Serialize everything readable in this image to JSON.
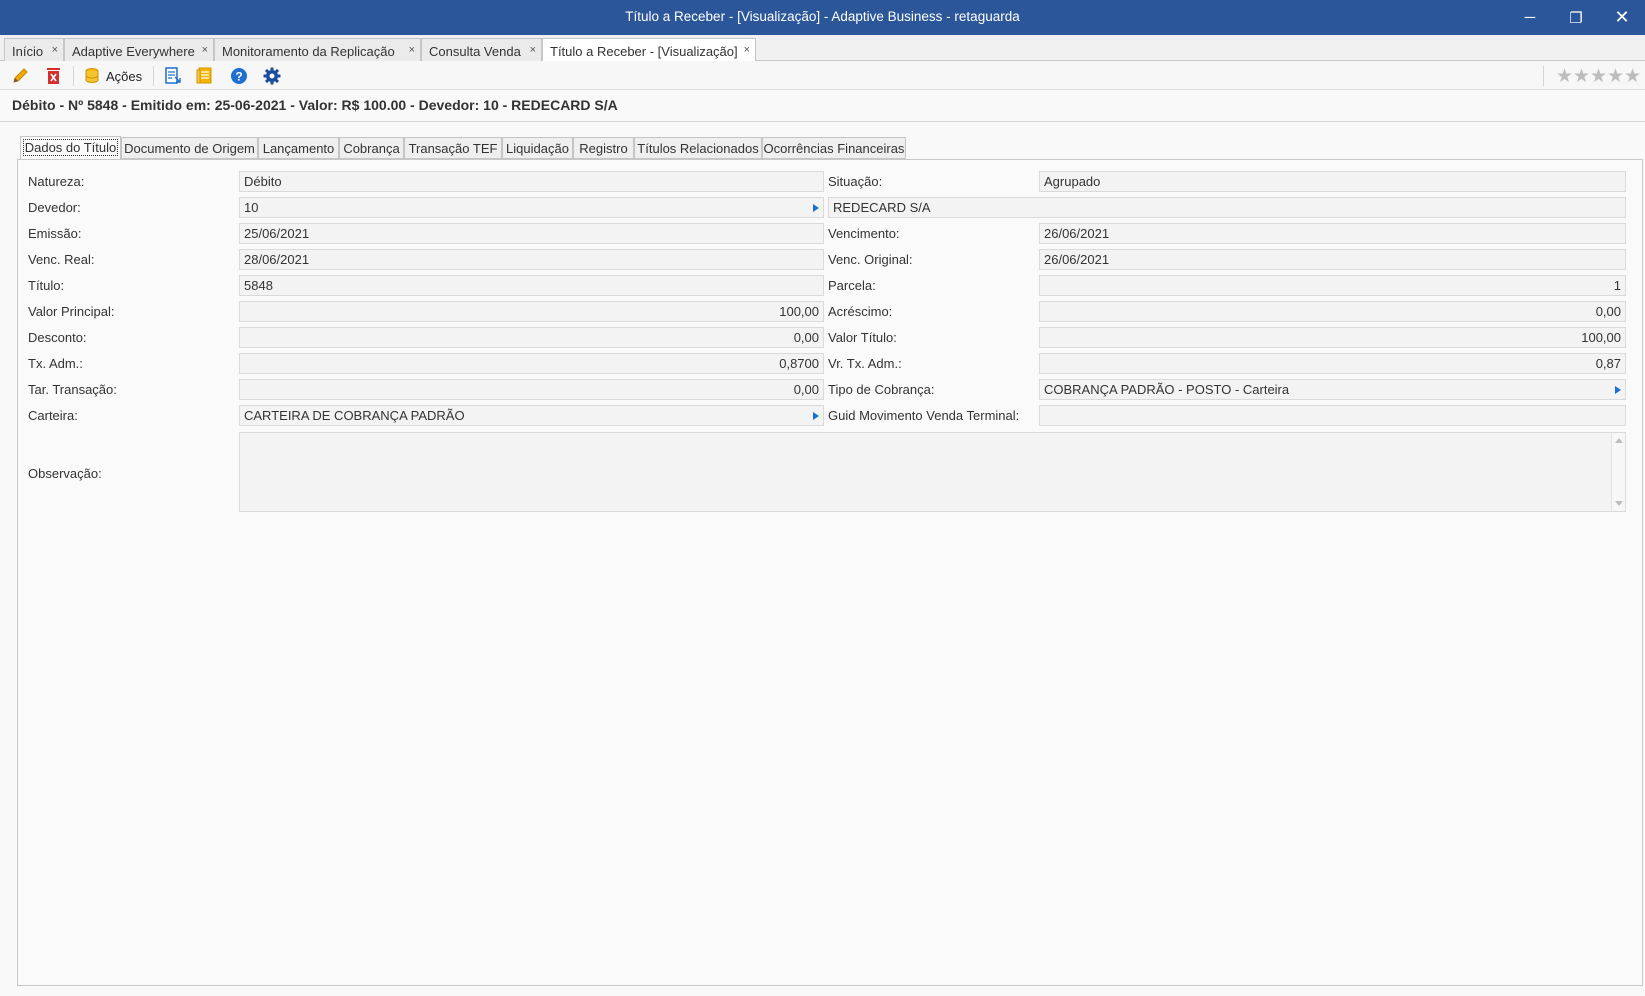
{
  "window": {
    "title": "Título a Receber - [Visualização] - Adaptive Business - retaguarda",
    "minimize": "─",
    "restore": "❐",
    "close": "✕"
  },
  "doc_tabs": [
    {
      "label": "Início",
      "close": "×"
    },
    {
      "label": "Adaptive Everywhere",
      "close": "×"
    },
    {
      "label": "Monitoramento da Replicação",
      "close": "×"
    },
    {
      "label": "Consulta Venda",
      "close": "×"
    },
    {
      "label": "Título a Receber - [Visualização]",
      "close": "×"
    }
  ],
  "toolbar": {
    "edit_icon": "pencil-icon",
    "delete_icon": "delete-icon",
    "actions_label": "Ações",
    "actions_icon": "database-icon",
    "report_icon": "report-icon",
    "notes_icon": "notes-icon",
    "help_icon": "help-icon",
    "settings_icon": "gear-icon",
    "rating": 0,
    "rating_max": 5
  },
  "header": {
    "title": "Débito - Nº 5848 - Emitido em: 25-06-2021 - Valor: R$ 100.00 - Devedor: 10 - REDECARD S/A"
  },
  "inner_tabs": [
    "Dados do Título",
    "Documento de Origem",
    "Lançamento",
    "Cobrança",
    "Transação TEF",
    "Liquidação",
    "Registro",
    "Títulos Relacionados",
    "Ocorrências Financeiras"
  ],
  "form": {
    "natureza_label": "Natureza:",
    "natureza": "Débito",
    "situacao_label": "Situação:",
    "situacao": "Agrupado",
    "devedor_label": "Devedor:",
    "devedor_code": "10",
    "devedor_name": "REDECARD S/A",
    "emissao_label": "Emissão:",
    "emissao": "25/06/2021",
    "vencimento_label": "Vencimento:",
    "vencimento": "26/06/2021",
    "venc_real_label": "Venc. Real:",
    "venc_real": "28/06/2021",
    "venc_original_label": "Venc. Original:",
    "venc_original": "26/06/2021",
    "titulo_label": "Título:",
    "titulo": "5848",
    "parcela_label": "Parcela:",
    "parcela": "1",
    "valor_principal_label": "Valor Principal:",
    "valor_principal": "100,00",
    "acrescimo_label": "Acréscimo:",
    "acrescimo": "0,00",
    "desconto_label": "Desconto:",
    "desconto": "0,00",
    "valor_titulo_label": "Valor Título:",
    "valor_titulo": "100,00",
    "tx_adm_label": "Tx. Adm.:",
    "tx_adm": "0,8700",
    "vr_tx_adm_label": "Vr. Tx. Adm.:",
    "vr_tx_adm": "0,87",
    "tar_transacao_label": "Tar. Transação:",
    "tar_transacao": "0,00",
    "tipo_cobranca_label": "Tipo de Cobrança:",
    "tipo_cobranca": "COBRANÇA PADRÃO - POSTO - Carteira",
    "carteira_label": "Carteira:",
    "carteira": "CARTEIRA DE COBRANÇA PADRÃO",
    "guid_label": "Guid Movimento Venda Terminal:",
    "guid": "",
    "observacao_label": "Observação:",
    "observacao": ""
  }
}
